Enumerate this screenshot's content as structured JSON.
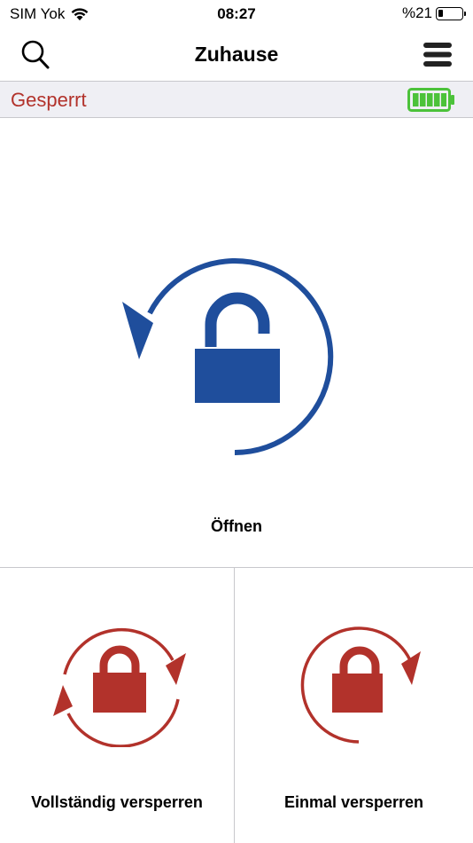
{
  "status_bar": {
    "carrier": "SIM Yok",
    "time": "08:27",
    "battery_percent": "%21",
    "battery_level": 0.21,
    "icons": [
      "wifi-icon",
      "battery-icon"
    ]
  },
  "nav": {
    "title": "Zuhause",
    "left_icon": "search-icon",
    "right_icon": "menu-icon"
  },
  "lock_status": {
    "state": "Gesperrt",
    "state_color": "#b2322b",
    "device_battery_icon": "battery-full-icon",
    "device_battery_color": "#4cc23a",
    "device_battery_segments": 5
  },
  "actions": {
    "open": {
      "label": "Öffnen",
      "icon": "unlock-rotate-icon",
      "color": "#1f4e9c"
    },
    "lock_full": {
      "label": "Vollständig versperren",
      "icon": "lock-double-rotate-icon",
      "color": "#b2322b"
    },
    "lock_once": {
      "label": "Einmal versperren",
      "icon": "lock-rotate-icon",
      "color": "#b2322b"
    }
  }
}
